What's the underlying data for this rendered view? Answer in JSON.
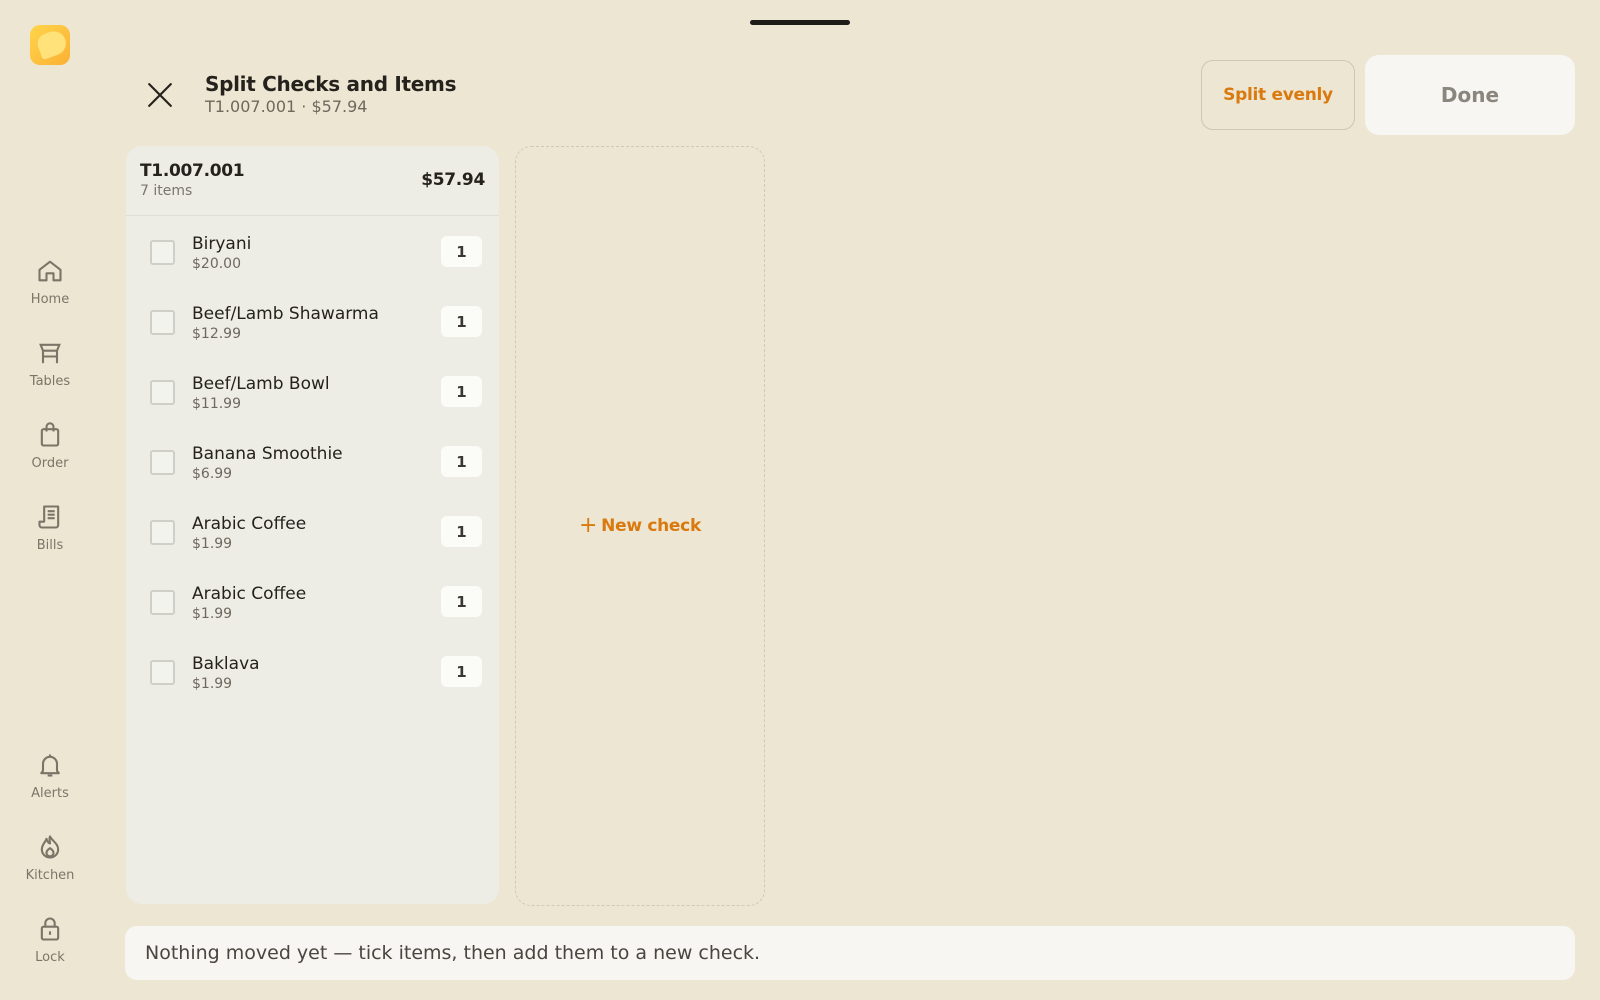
{
  "header": {
    "title": "Split Checks and Items",
    "subtitle": "T1.007.001 · $57.94",
    "split_evenly_label": "Split evenly",
    "done_label": "Done"
  },
  "sidebar": {
    "items": [
      {
        "label": "Home",
        "icon": "home-icon"
      },
      {
        "label": "Tables",
        "icon": "table-icon"
      },
      {
        "label": "Order",
        "icon": "shopping-bag-icon"
      },
      {
        "label": "Bills",
        "icon": "receipt-icon"
      },
      {
        "label": "Alerts",
        "icon": "bell-icon"
      },
      {
        "label": "Kitchen",
        "icon": "flame-icon"
      },
      {
        "label": "Lock",
        "icon": "lock-icon"
      }
    ]
  },
  "check": {
    "id": "T1.007.001",
    "count": "7 items",
    "total": "$57.94",
    "items": [
      {
        "name": "Biryani",
        "price": "$20.00",
        "qty": "1"
      },
      {
        "name": "Beef/Lamb Shawarma",
        "price": "$12.99",
        "qty": "1"
      },
      {
        "name": "Beef/Lamb Bowl",
        "price": "$11.99",
        "qty": "1"
      },
      {
        "name": "Banana Smoothie",
        "price": "$6.99",
        "qty": "1"
      },
      {
        "name": "Arabic Coffee",
        "price": "$1.99",
        "qty": "1"
      },
      {
        "name": "Arabic Coffee",
        "price": "$1.99",
        "qty": "1"
      },
      {
        "name": "Baklava",
        "price": "$1.99",
        "qty": "1"
      }
    ]
  },
  "new_check": {
    "plus": "+",
    "label": "New check"
  },
  "status": {
    "message": "Nothing moved yet — tick items, then add them to a new check."
  },
  "colors": {
    "accent": "#d9790e",
    "background": "#ede6d3",
    "card": "#edede6"
  }
}
